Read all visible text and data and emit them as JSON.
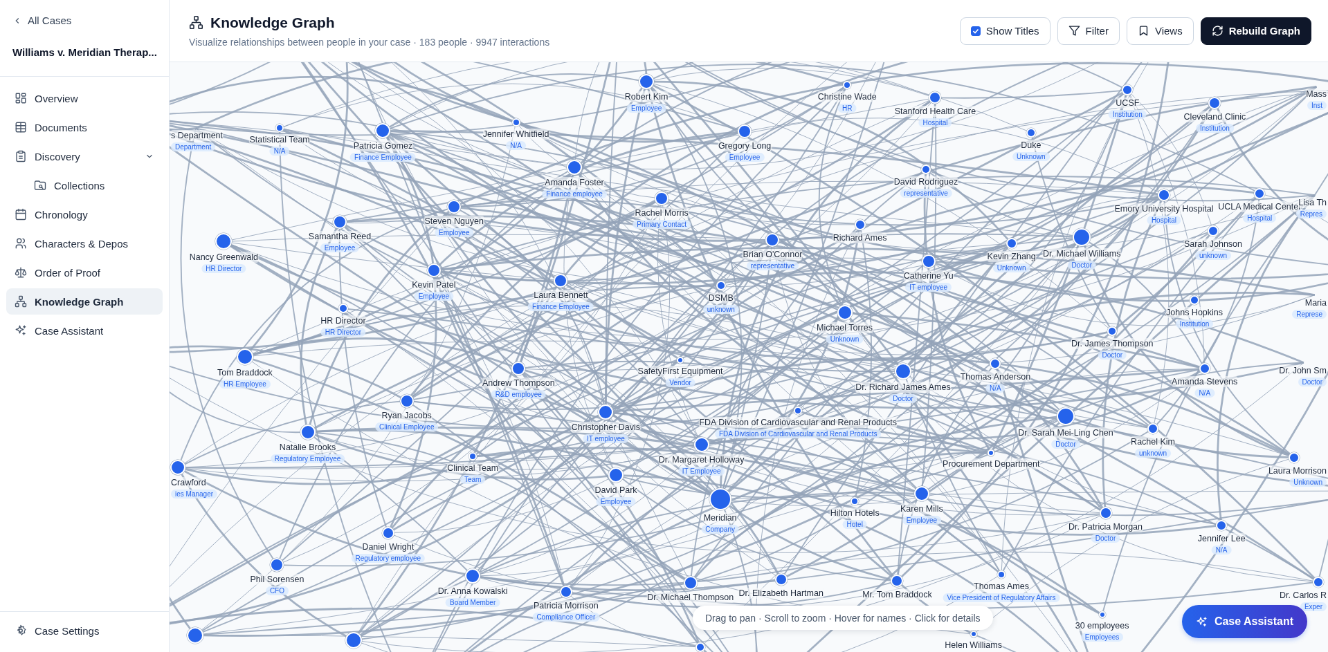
{
  "sidebar": {
    "back_link": "All Cases",
    "case_title": "Williams v. Meridian Therap...",
    "items": [
      {
        "label": "Overview",
        "selected": false
      },
      {
        "label": "Documents",
        "selected": false
      },
      {
        "label": "Discovery",
        "selected": false,
        "expanded": true,
        "children": [
          {
            "label": "Collections",
            "selected": false
          }
        ]
      },
      {
        "label": "Chronology",
        "selected": false
      },
      {
        "label": "Characters & Depos",
        "selected": false
      },
      {
        "label": "Order of Proof",
        "selected": false
      },
      {
        "label": "Knowledge Graph",
        "selected": true
      },
      {
        "label": "Case Assistant",
        "selected": false
      }
    ],
    "settings": "Case Settings"
  },
  "header": {
    "title": "Knowledge Graph",
    "subtitle": "Visualize relationships between people in your case · 183 people · 9947 interactions",
    "show_titles": {
      "label": "Show Titles",
      "checked": true
    },
    "buttons": [
      {
        "label": "Filter",
        "kind": "filter"
      },
      {
        "label": "Views",
        "kind": "views"
      },
      {
        "label": "Rebuild Graph",
        "kind": "rebuild"
      }
    ]
  },
  "graph": {
    "nodes": [
      {
        "name": "s Department",
        "role": "Department"
      },
      {
        "name": "Statistical Team",
        "role": "N/A"
      },
      {
        "name": "Patricia Gomez",
        "role": "Finance Employee"
      },
      {
        "name": "Jennifer Whitfield",
        "role": "N/A"
      },
      {
        "name": "Robert Kim",
        "role": "Employee"
      },
      {
        "name": "Christine Wade",
        "role": "HR"
      },
      {
        "name": "Stanford Health Care",
        "role": "Hospital"
      },
      {
        "name": "Gregory Long",
        "role": "Employee"
      },
      {
        "name": "UCSF",
        "role": "Institution"
      },
      {
        "name": "Cleveland Clinic",
        "role": "Institution"
      },
      {
        "name": "Mass",
        "role": "Inst"
      },
      {
        "name": "Duke",
        "role": "Unknown"
      },
      {
        "name": "Amanda Foster",
        "role": "Finance employee"
      },
      {
        "name": "David Rodriguez",
        "role": "representative"
      },
      {
        "name": "Steven Nguyen",
        "role": "Employee"
      },
      {
        "name": "Rachel Morris",
        "role": "Primary Contact"
      },
      {
        "name": "Samantha Reed",
        "role": "Employee"
      },
      {
        "name": "Nancy Greenwald",
        "role": "HR Director"
      },
      {
        "name": "Emory University Hospital",
        "role": "Hospital"
      },
      {
        "name": "UCLA Medical Center",
        "role": "Hospital"
      },
      {
        "name": "Lisa Th",
        "role": "Repres"
      },
      {
        "name": "Richard Ames"
      },
      {
        "name": "Brian O'Connor",
        "role": "representative"
      },
      {
        "name": "Kevin Zhang",
        "role": "Unknown"
      },
      {
        "name": "Dr. Michael Williams",
        "role": "Doctor"
      },
      {
        "name": "Sarah Johnson",
        "role": "unknown"
      },
      {
        "name": "Catherine Yu",
        "role": "IT employee"
      },
      {
        "name": "Kevin Patel",
        "role": "Employee"
      },
      {
        "name": "Laura Bennett",
        "role": "Finance Employee"
      },
      {
        "name": "DSMB",
        "role": "unknown"
      },
      {
        "name": "Maria",
        "role": "Represe"
      },
      {
        "name": "HR Director",
        "role": "HR Director"
      },
      {
        "name": "Michael Torres",
        "role": "Unknown"
      },
      {
        "name": "Johns Hopkins",
        "role": "Institution"
      },
      {
        "name": "Dr. James Thompson",
        "role": "Doctor"
      },
      {
        "name": "Tom Braddock",
        "role": "HR Employee"
      },
      {
        "name": "SafetyFirst Equipment",
        "role": "Vendor"
      },
      {
        "name": "Andrew Thompson",
        "role": "R&D employee"
      },
      {
        "name": "Thomas Anderson",
        "role": "N/A"
      },
      {
        "name": "Dr. Richard James Ames",
        "role": "Doctor"
      },
      {
        "name": "Amanda Stevens",
        "role": "N/A"
      },
      {
        "name": "Dr. John Sm",
        "role": "Doctor"
      },
      {
        "name": "Ryan Jacobs",
        "role": "Clinical Employee"
      },
      {
        "name": "FDA Division of Cardiovascular and Renal Products",
        "role": "FDA Division of Cardiovascular and Renal Products"
      },
      {
        "name": "Christopher Davis",
        "role": "IT employee"
      },
      {
        "name": "Dr. Sarah Mei-Ling Chen",
        "role": "Doctor"
      },
      {
        "name": "Natalie Brooks",
        "role": "Regulatory Employee"
      },
      {
        "name": "Rachel Kim",
        "role": "unknown"
      },
      {
        "name": "Dr. Margaret Holloway",
        "role": "IT Employee"
      },
      {
        "name": "Crawford",
        "role": "ies Manager"
      },
      {
        "name": "Clinical Team",
        "role": "Team"
      },
      {
        "name": "Procurement Department"
      },
      {
        "name": "Laura Morrison",
        "role": "Unknown"
      },
      {
        "name": "David Park",
        "role": "Employee"
      },
      {
        "name": "Meridian",
        "role": "Company"
      },
      {
        "name": "Hilton Hotels",
        "role": "Hotel"
      },
      {
        "name": "Karen Mills",
        "role": "Employee"
      },
      {
        "name": "Dr. Patricia Morgan",
        "role": "Doctor"
      },
      {
        "name": "Jennifer Lee",
        "role": "N/A"
      },
      {
        "name": "Daniel Wright",
        "role": "Regulatory employee"
      },
      {
        "name": "Phil Sorensen",
        "role": "CFO"
      },
      {
        "name": "Dr. Anna Kowalski",
        "role": "Board Member"
      },
      {
        "name": "Patricia Morrison",
        "role": "Compliance Officer"
      },
      {
        "name": "Dr. Michael Thompson"
      },
      {
        "name": "Dr. Elizabeth Hartman"
      },
      {
        "name": "Mr. Tom Braddock"
      },
      {
        "name": "Thomas Ames",
        "role": "Vice President of Regulatory Affairs"
      },
      {
        "name": "30 employees",
        "role": "Employees"
      },
      {
        "name": "Dr. Carlos R",
        "role": "Exper"
      },
      {
        "name": "Helen Williams"
      }
    ],
    "hint": "Drag to pan · Scroll to zoom · Hover for names · Click for details",
    "assistant_button": "Case Assistant"
  }
}
